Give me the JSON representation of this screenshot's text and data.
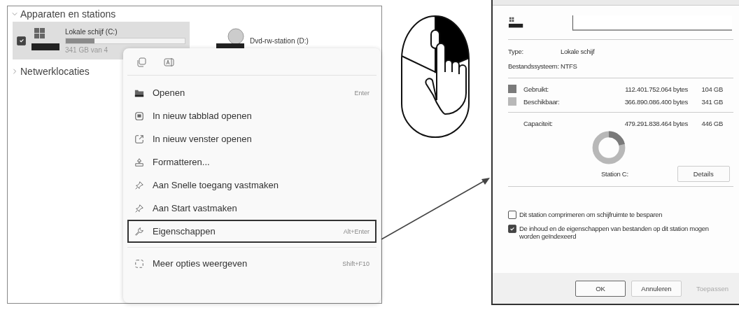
{
  "explorer": {
    "sections": [
      {
        "label": "Apparaten en stations",
        "expanded": true
      },
      {
        "label": "Netwerklocaties",
        "expanded": false
      }
    ],
    "drives": [
      {
        "name": "Lokale schijf (C:)",
        "selected": true,
        "checked": true,
        "level": 0.24,
        "free": "341 GB van 4",
        "kind": "disk"
      },
      {
        "name": "Dvd-rw-station (D:)",
        "selected": false,
        "kind": "dvd"
      }
    ]
  },
  "context_menu": {
    "items": [
      {
        "label": "Openen",
        "shortcut": "Enter",
        "kind": "folder",
        "selected": false
      },
      {
        "label": "In nieuw tabblad openen",
        "kind": "tab",
        "selected": false
      },
      {
        "label": "In nieuw venster openen",
        "kind": "window",
        "selected": false
      },
      {
        "label": "Formatteren...",
        "kind": "format",
        "selected": false
      },
      {
        "label": "Aan Snelle toegang vastmaken",
        "kind": "pin",
        "selected": false
      },
      {
        "label": "Aan Start vastmaken",
        "kind": "pin",
        "selected": false
      },
      {
        "label": "Eigenschappen",
        "shortcut": "Alt+Enter",
        "kind": "wrench",
        "selected": true
      },
      {
        "label": "Meer opties weergeven",
        "shortcut": "Shift+F10",
        "kind": "more",
        "selected": false
      }
    ]
  },
  "properties": {
    "type_label": "Type:",
    "type_value": "Lokale schijf",
    "fs_label": "Bestandssysteem:",
    "fs_value": "NTFS",
    "usage": [
      {
        "label": "Gebruikt:",
        "bytes": "112.401.752.064 bytes",
        "size": "104 GB",
        "color": "#7a7a7a"
      },
      {
        "label": "Beschikbaar:",
        "bytes": "366.890.086.400 bytes",
        "size": "341 GB",
        "color": "#b8b8b8"
      }
    ],
    "capacity": {
      "label": "Capaciteit:",
      "bytes": "479.291.838.464 bytes",
      "size": "446 GB"
    },
    "drive_label": "Station C:",
    "details_button": "Details",
    "options": [
      {
        "label": "Dit station comprimeren om schijfruimte te besparen",
        "checked": false
      },
      {
        "label": "De inhoud en de eigenschappen van bestanden op dit station mogen worden geïndexeerd",
        "checked": true
      }
    ],
    "buttons": [
      {
        "label": "OK",
        "disabled": false
      },
      {
        "label": "Annuleren",
        "disabled": false
      },
      {
        "label": "Toepassen",
        "disabled": true
      }
    ]
  }
}
